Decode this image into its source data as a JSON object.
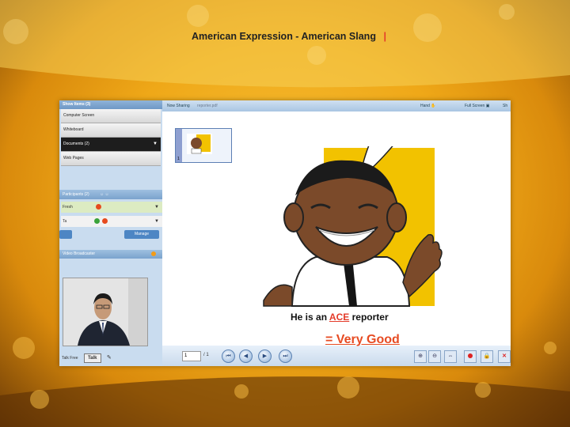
{
  "left_panel": {
    "header": "Show Items (3)",
    "items": [
      {
        "label": "Computer Screen"
      },
      {
        "label": "Whiteboard"
      },
      {
        "label": "Documents (2)",
        "selected": true
      },
      {
        "label": "Web Pages"
      }
    ],
    "participants_header": "Participants (2)",
    "participants": [
      {
        "name": "Fresh"
      },
      {
        "name": "Ta"
      }
    ],
    "buttons": {
      "left": "",
      "manage": "Manage"
    },
    "video_header": "Video Broadcaster",
    "footer": {
      "label": "Talk Free",
      "talk_button": "Talk"
    }
  },
  "top_bar": {
    "tab": "Now Sharing",
    "file": "reporter.pdf",
    "hand_label": "Hand",
    "fullscreen_label": "Full Screen",
    "extra_label": "Sh"
  },
  "slide": {
    "title": "American Expression - American Slang",
    "caption_prefix": "He is an",
    "caption_highlight": "ACE",
    "caption_suffix": "reporter",
    "meaning": "= Very Good",
    "thumbnail_label": "1"
  },
  "pager": {
    "current": "1",
    "total_label": "/ 1"
  },
  "colors": {
    "accent_red": "#e43b2a",
    "comic_yellow": "#f2c200",
    "panel_blue": "#c9dcef",
    "background_gold": "#efa818"
  },
  "icons": [
    "first-page-icon",
    "prev-page-icon",
    "play-icon",
    "last-page-icon",
    "zoom-in-icon",
    "zoom-out-icon",
    "fit-icon",
    "record-icon",
    "lock-icon",
    "close-icon"
  ]
}
